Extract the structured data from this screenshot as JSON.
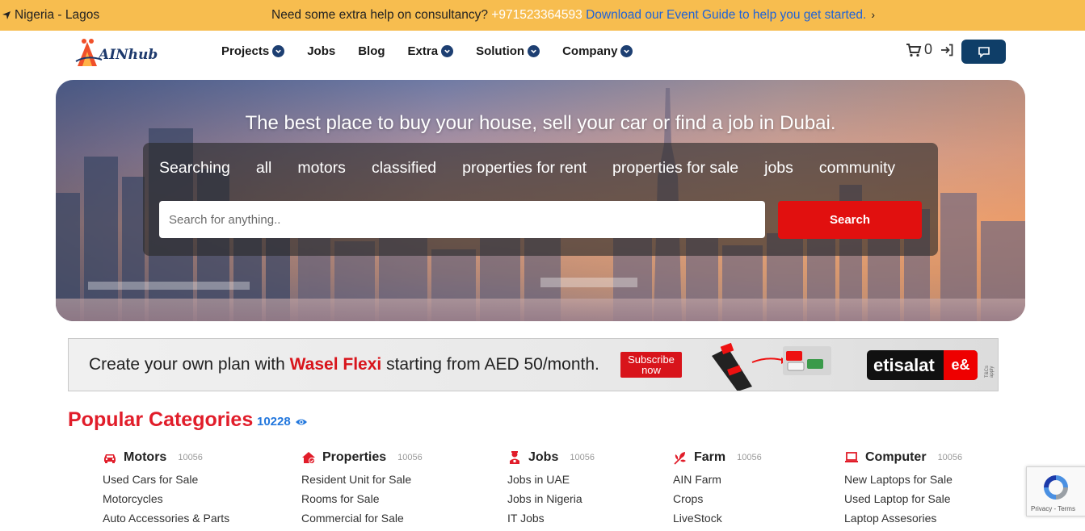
{
  "topbar": {
    "location": "Nigeria - Lagos",
    "message": "Need some extra help on consultancy? ",
    "phone": "+971523364593",
    "guide_link": "Download our Event Guide to help you get started.",
    "chevron": "›"
  },
  "nav": {
    "logo_text": "AINhub",
    "menu": [
      {
        "label": "Projects",
        "dropdown": true
      },
      {
        "label": "Jobs",
        "dropdown": false
      },
      {
        "label": "Blog",
        "dropdown": false
      },
      {
        "label": "Extra",
        "dropdown": true
      },
      {
        "label": "Solution",
        "dropdown": true
      },
      {
        "label": "Company",
        "dropdown": true
      }
    ],
    "cart_count": "0",
    "icons": [
      "cart-icon",
      "login-icon",
      "chat-icon"
    ]
  },
  "hero": {
    "title": "The best place to buy your house, sell your car or find a job in Dubai.",
    "tabs": [
      "Searching",
      "all",
      "motors",
      "classified",
      "properties for rent",
      "properties for sale",
      "jobs",
      "community"
    ],
    "search_placeholder": "Search for anything..",
    "search_button": "Search"
  },
  "ad": {
    "text_before": "Create your own plan with ",
    "highlight": "Wasel Flexi",
    "text_after": " starting from AED 50/month.",
    "subscribe_line1": "Subscribe",
    "subscribe_line2": "now",
    "brand": "etisalat",
    "brand_suffix": "e&",
    "tcs": "T&Cs apply"
  },
  "categories": {
    "title": "Popular Categories",
    "count": "10228",
    "columns": [
      {
        "name": "Motors",
        "count": "10056",
        "icon": "car-icon",
        "links": [
          "Used Cars for Sale",
          "Motorcycles",
          "Auto Accessories & Parts"
        ]
      },
      {
        "name": "Properties",
        "count": "10056",
        "icon": "house-icon",
        "links": [
          "Resident Unit for Sale",
          "Rooms for Sale",
          "Commercial for Sale"
        ]
      },
      {
        "name": "Jobs",
        "count": "10056",
        "icon": "worker-icon",
        "links": [
          "Jobs in UAE",
          "Jobs in Nigeria",
          "IT Jobs"
        ]
      },
      {
        "name": "Farm",
        "count": "10056",
        "icon": "plant-icon",
        "links": [
          "AIN Farm",
          "Crops",
          "LiveStock"
        ]
      },
      {
        "name": "Computer",
        "count": "10056",
        "icon": "laptop-icon",
        "links": [
          "New Laptops for Sale",
          "Used Laptop for Sale",
          "Laptop Assesories"
        ]
      }
    ]
  },
  "recaptcha": {
    "text": "Privacy - Terms"
  },
  "colors": {
    "topbar": "#f7bd4f",
    "accent_red": "#e11d2a",
    "navy": "#0f3e68",
    "link_blue": "#1f63d8"
  }
}
